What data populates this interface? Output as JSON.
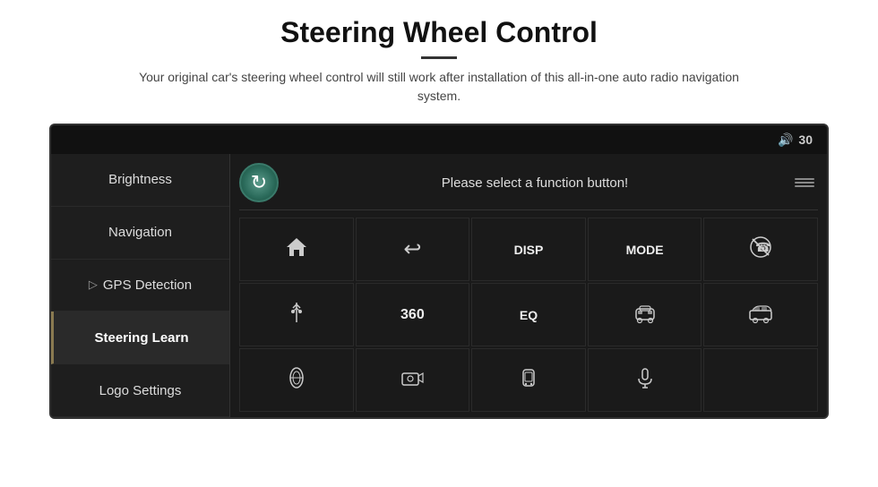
{
  "header": {
    "title": "Steering Wheel Control",
    "divider": true,
    "subtitle": "Your original car's steering wheel control will still work after installation of this all-in-one auto radio navigation system."
  },
  "device": {
    "topbar": {
      "volume_icon": "🔊",
      "volume_level": "30"
    },
    "sidebar": {
      "items": [
        {
          "label": "Brightness",
          "active": false
        },
        {
          "label": "Navigation",
          "active": false
        },
        {
          "label": "GPS Detection",
          "active": false
        },
        {
          "label": "Steering Learn",
          "active": true
        },
        {
          "label": "Logo Settings",
          "active": false
        }
      ]
    },
    "main": {
      "refresh_label": "↻",
      "function_prompt": "Please select a function button!",
      "grid": {
        "rows": [
          [
            {
              "type": "home",
              "label": "🏠"
            },
            {
              "type": "back",
              "label": "↩"
            },
            {
              "type": "text",
              "label": "DISP"
            },
            {
              "type": "text",
              "label": "MODE"
            },
            {
              "type": "no-call",
              "label": "📵"
            }
          ],
          [
            {
              "type": "svg-antenna",
              "label": "antenna"
            },
            {
              "type": "text-bold",
              "label": "360"
            },
            {
              "type": "text",
              "label": "EQ"
            },
            {
              "type": "svg-car-front",
              "label": "car-front"
            },
            {
              "type": "svg-car-side",
              "label": "car-side"
            }
          ],
          [
            {
              "type": "svg-car-top",
              "label": "car-top"
            },
            {
              "type": "svg-camera",
              "label": "camera"
            },
            {
              "type": "svg-car-top2",
              "label": "car-top2"
            },
            {
              "type": "svg-mic",
              "label": "microphone"
            },
            {
              "type": "empty",
              "label": ""
            }
          ]
        ]
      }
    }
  }
}
